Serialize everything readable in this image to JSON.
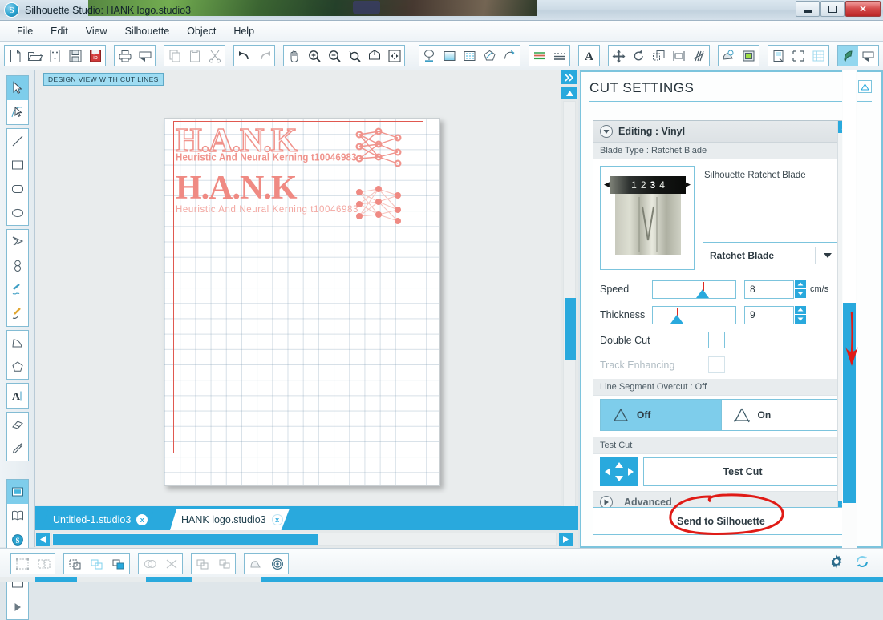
{
  "window": {
    "title": "Silhouette Studio: HANK logo.studio3",
    "app_icon": "silhouette-logo-icon",
    "minimize_label": "Minimize",
    "maximize_label": "Maximize",
    "close_label": "Close",
    "close_glyph": "✕"
  },
  "menu": {
    "items": [
      {
        "label": "File"
      },
      {
        "label": "Edit"
      },
      {
        "label": "View"
      },
      {
        "label": "Silhouette"
      },
      {
        "label": "Object"
      },
      {
        "label": "Help"
      }
    ]
  },
  "toolbar": {
    "groups": [
      {
        "name": "file",
        "buttons": [
          {
            "name": "new-document-icon"
          },
          {
            "name": "open-folder-icon"
          },
          {
            "name": "new-from-template-icon"
          },
          {
            "name": "save-icon"
          },
          {
            "name": "save-to-library-icon"
          }
        ]
      },
      {
        "name": "print",
        "buttons": [
          {
            "name": "print-icon"
          },
          {
            "name": "print-preview-icon"
          }
        ]
      },
      {
        "name": "clipboard",
        "buttons": [
          {
            "name": "copy-icon"
          },
          {
            "name": "paste-icon"
          },
          {
            "name": "cut-scissors-icon"
          }
        ]
      },
      {
        "name": "history",
        "buttons": [
          {
            "name": "undo-icon"
          },
          {
            "name": "redo-icon"
          }
        ]
      },
      {
        "name": "view",
        "buttons": [
          {
            "name": "pan-hand-icon"
          },
          {
            "name": "zoom-in-icon"
          },
          {
            "name": "zoom-out-icon"
          },
          {
            "name": "zoom-selection-icon"
          },
          {
            "name": "zoom-region-icon"
          },
          {
            "name": "fit-to-window-icon"
          }
        ]
      },
      {
        "name": "style",
        "buttons": [
          {
            "name": "fill-color-icon"
          },
          {
            "name": "fill-gradient-icon"
          },
          {
            "name": "fill-pattern-icon"
          },
          {
            "name": "line-color-icon"
          },
          {
            "name": "line-style-icon"
          }
        ]
      },
      {
        "name": "lines",
        "buttons": [
          {
            "name": "line-thickness-icon"
          },
          {
            "name": "dashed-line-icon"
          }
        ]
      },
      {
        "name": "text",
        "buttons": [
          {
            "name": "text-style-icon"
          }
        ]
      },
      {
        "name": "transform",
        "buttons": [
          {
            "name": "move-icon"
          },
          {
            "name": "rotate-icon"
          },
          {
            "name": "scale-icon"
          },
          {
            "name": "align-icon"
          },
          {
            "name": "replicate-icon"
          }
        ]
      },
      {
        "name": "effects",
        "buttons": [
          {
            "name": "offset-icon"
          },
          {
            "name": "trace-icon"
          }
        ]
      },
      {
        "name": "page",
        "buttons": [
          {
            "name": "page-setup-icon"
          },
          {
            "name": "registration-marks-icon"
          },
          {
            "name": "grid-icon"
          }
        ]
      },
      {
        "name": "cut",
        "buttons": [
          {
            "name": "cut-settings-icon",
            "selected": true
          },
          {
            "name": "send-to-silhouette-icon"
          }
        ]
      }
    ]
  },
  "left_tools": {
    "groups": [
      {
        "name": "select",
        "tools": [
          {
            "name": "select-arrow-tool",
            "selected": true
          },
          {
            "name": "edit-points-tool",
            "selected": false
          }
        ]
      },
      {
        "name": "shapes",
        "tools": [
          {
            "name": "line-tool"
          },
          {
            "name": "rectangle-tool"
          },
          {
            "name": "rounded-rectangle-tool"
          },
          {
            "name": "ellipse-tool"
          }
        ]
      },
      {
        "name": "draw",
        "tools": [
          {
            "name": "polygon-tool"
          },
          {
            "name": "curve-tool"
          },
          {
            "name": "freehand-tool"
          },
          {
            "name": "smooth-freehand-tool"
          }
        ]
      },
      {
        "name": "misc",
        "tools": [
          {
            "name": "arc-tool"
          },
          {
            "name": "regular-polygon-tool"
          }
        ]
      },
      {
        "name": "text-group",
        "tools": [
          {
            "name": "text-tool"
          }
        ]
      },
      {
        "name": "erase-group",
        "tools": [
          {
            "name": "eraser-tool"
          },
          {
            "name": "knife-tool"
          }
        ]
      },
      {
        "name": "panels",
        "tools": [
          {
            "name": "design-page-panel",
            "selected": true
          },
          {
            "name": "library-panel"
          },
          {
            "name": "store-panel"
          }
        ]
      },
      {
        "name": "playback",
        "tools": [
          {
            "name": "window-panel-tool"
          },
          {
            "name": "play-tool"
          }
        ]
      }
    ]
  },
  "canvas": {
    "view_badge": "DESIGN VIEW WITH CUT LINES",
    "mat_arrow_icon": "mat-feed-arrow-icon",
    "artwork": {
      "outline_title": "H.A.N.K",
      "outline_subtitle": "Heuristic And Neural Kerning t10046983",
      "filled_title": "H.A.N.K",
      "filled_subtitle": "Heuristic And Neural Kerning t10046983",
      "neural_net_icon": "neural-network-icon",
      "cut_line_color": "#e0584f",
      "artwork_color": "#ef8a83"
    },
    "scroll": {
      "expand_icon": "expand-panel-icon",
      "up_icon": "scroll-up-icon",
      "down_icon": "scroll-down-icon",
      "left_icon": "scroll-left-icon",
      "right_icon": "scroll-right-icon"
    }
  },
  "tabs": [
    {
      "label": "Untitled-1.studio3",
      "active": false,
      "close_glyph": "x"
    },
    {
      "label": "HANK logo.studio3",
      "active": true,
      "close_glyph": "x"
    }
  ],
  "cut_settings": {
    "panel_title": "CUT SETTINGS",
    "collapse_icon": "collapse-up-icon",
    "expand_icon": "expand-up-outline-icon",
    "card_header": "Editing : Vinyl",
    "card_header_icon": "chevron-down-circle-icon",
    "blade_type_label": "Blade Type : Ratchet Blade",
    "blade_name": "Silhouette Ratchet Blade",
    "blade_dial_values": [
      "1",
      "2",
      "3",
      "4"
    ],
    "blade_dial_selected": "3",
    "blade_dial_left_icon": "dial-left-arrow-icon",
    "blade_dial_right_icon": "dial-right-arrow-icon",
    "blade_select_value": "Ratchet Blade",
    "blade_select_icon": "dropdown-arrow-icon",
    "speed": {
      "label": "Speed",
      "value": "8",
      "unit": "cm/s",
      "slider_percent": 62,
      "up_icon": "stepper-up-icon",
      "down_icon": "stepper-down-icon"
    },
    "thickness": {
      "label": "Thickness",
      "value": "9",
      "unit": "",
      "slider_percent": 30,
      "up_icon": "stepper-up-icon",
      "down_icon": "stepper-down-icon"
    },
    "double_cut": {
      "label": "Double Cut",
      "checked": false
    },
    "track_enhancing": {
      "label": "Track Enhancing",
      "checked": false,
      "disabled": true
    },
    "line_segment_overcut": {
      "heading": "Line Segment Overcut : Off",
      "options": [
        {
          "label": "Off",
          "icon": "triangle-closed-icon",
          "selected": true
        },
        {
          "label": "On",
          "icon": "triangle-overcut-icon",
          "selected": false
        }
      ]
    },
    "test_cut": {
      "heading": "Test Cut",
      "dpad_icon": "dpad-arrows-icon",
      "button_label": "Test Cut"
    },
    "advanced": {
      "label": "Advanced",
      "icon": "chevron-right-circle-icon"
    },
    "send_button": "Send to Silhouette",
    "scroll": {
      "up_icon": "scroll-up-icon",
      "down_icon": "scroll-down-icon"
    }
  },
  "annotations": {
    "red_arrow": "red-down-arrow-annotation",
    "red_circle": "red-ellipse-annotation",
    "color": "#e01b16"
  },
  "bottom_bar": {
    "groups": [
      {
        "name": "group-arrange",
        "buttons": [
          {
            "name": "group-icon"
          },
          {
            "name": "ungroup-icon"
          }
        ]
      },
      {
        "name": "order",
        "buttons": [
          {
            "name": "bring-to-front-icon"
          },
          {
            "name": "send-backward-icon"
          },
          {
            "name": "bring-forward-icon"
          }
        ]
      },
      {
        "name": "weld",
        "buttons": [
          {
            "name": "weld-icon"
          },
          {
            "name": "detach-icon"
          }
        ]
      },
      {
        "name": "modify",
        "buttons": [
          {
            "name": "subtract-icon"
          },
          {
            "name": "intersect-icon"
          }
        ]
      },
      {
        "name": "offsets",
        "buttons": [
          {
            "name": "offset-shape-icon"
          },
          {
            "name": "concentric-offset-icon"
          }
        ]
      }
    ],
    "right_buttons": [
      {
        "name": "preferences-gear-icon"
      },
      {
        "name": "sync-refresh-icon"
      }
    ]
  },
  "colors": {
    "accent": "#29a9dd",
    "accent_light": "#7ecdeb",
    "panel_border": "#7cc4dd",
    "annotation_red": "#e01b16",
    "artwork_pink": "#ef8a83"
  }
}
